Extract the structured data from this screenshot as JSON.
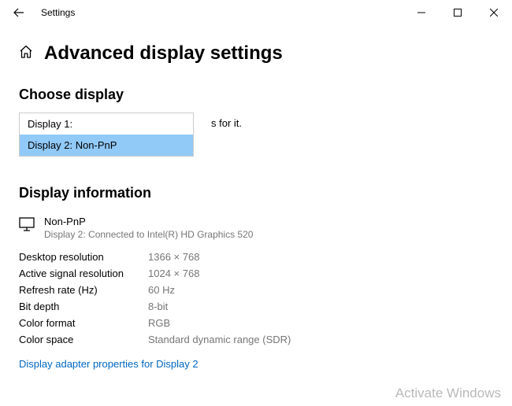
{
  "window": {
    "title": "Settings"
  },
  "page": {
    "title": "Advanced display settings"
  },
  "choose": {
    "heading": "Choose display",
    "behind_fragment": "s for it.",
    "options": [
      {
        "label": "Display 1:"
      },
      {
        "label": "Display 2: Non-PnP"
      }
    ]
  },
  "info": {
    "heading": "Display information",
    "monitor_name": "Non-PnP",
    "monitor_sub": "Display 2: Connected to Intel(R) HD Graphics 520",
    "specs": [
      {
        "label": "Desktop resolution",
        "value": "1366 × 768"
      },
      {
        "label": "Active signal resolution",
        "value": "1024 × 768"
      },
      {
        "label": "Refresh rate (Hz)",
        "value": "60 Hz"
      },
      {
        "label": "Bit depth",
        "value": "8-bit"
      },
      {
        "label": "Color format",
        "value": "RGB"
      },
      {
        "label": "Color space",
        "value": "Standard dynamic range (SDR)"
      }
    ],
    "link": "Display adapter properties for Display 2"
  },
  "watermark": "Activate Windows"
}
